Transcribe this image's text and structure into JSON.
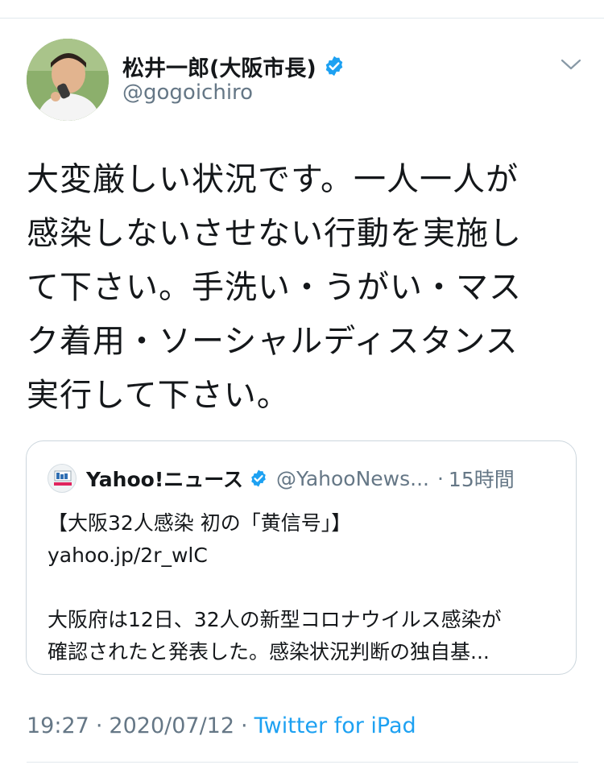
{
  "colors": {
    "accent": "#1da1f2",
    "text_primary": "#14171a",
    "text_secondary": "#657786",
    "border": "#ccd6dd"
  },
  "tweet": {
    "author": {
      "display_name": "松井一郎(大阪市長)",
      "handle": "@gogoichiro",
      "verified": true,
      "avatar_icon": "profile-photo"
    },
    "menu_icon": "chevron-down-icon",
    "text_lines": [
      "大変厳しい状況です。一人一人が",
      "感染しないさせない行動を実施し",
      "て下さい。手洗い・うがい・マス",
      "ク着用・ソーシャルディスタンス",
      "実行して下さい。"
    ],
    "quoted": {
      "name": "Yahoo!ニュース",
      "handle": "@YahooNews...",
      "separator": "·",
      "time": "15時間",
      "verified": true,
      "headline": "【大阪32人感染 初の「黄信号」】",
      "link": "yahoo.jp/2r_wlC",
      "body_lines": [
        "大阪府は12日、32人の新型コロナウイルス感染が",
        "確認されたと発表した。感染状況判断の独自基..."
      ]
    },
    "meta": {
      "time": "19:27",
      "separator1": "·",
      "date": "2020/07/12",
      "separator2": "·",
      "source": "Twitter for iPad"
    }
  }
}
